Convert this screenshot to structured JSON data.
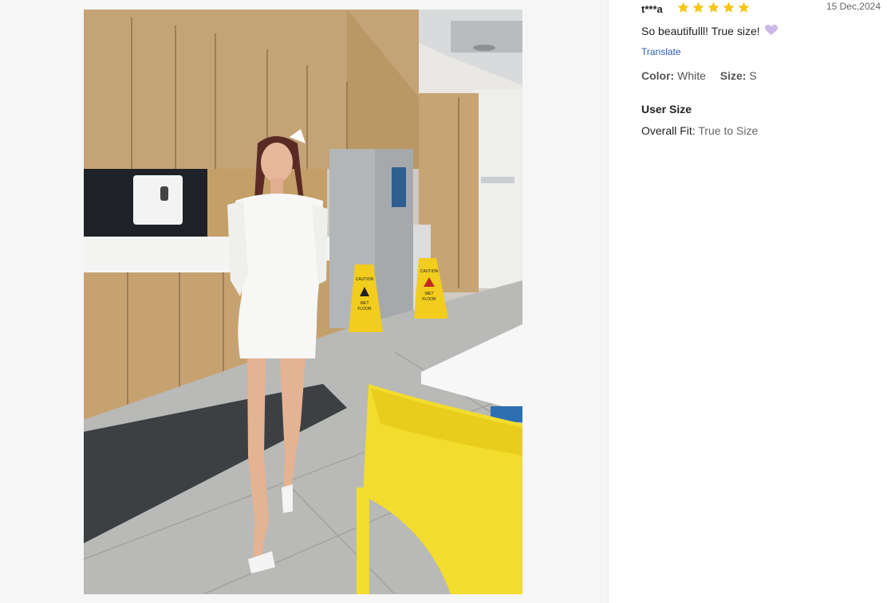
{
  "review": {
    "reviewer": "t***a",
    "rating": 5,
    "max_rating": 5,
    "date": "15 Dec,2024",
    "text": "So beautifulll! True size!",
    "translate_label": "Translate",
    "color_label": "Color:",
    "color_value": "White",
    "size_label": "Size:",
    "size_value": "S",
    "user_size_title": "User Size",
    "fit_label": "Overall Fit:",
    "fit_value": "True to Size"
  },
  "photo": {
    "sign_left": [
      "CAUTION",
      "WET",
      "FLOOR"
    ],
    "sign_right": [
      "CAUTION",
      "WET",
      "FLOOR"
    ]
  },
  "icons": {
    "star": "star-icon",
    "heart": "purple-heart-icon"
  },
  "colors": {
    "star": "#f5c518",
    "link": "#2a5db0",
    "heart": "#c9b3e8"
  }
}
